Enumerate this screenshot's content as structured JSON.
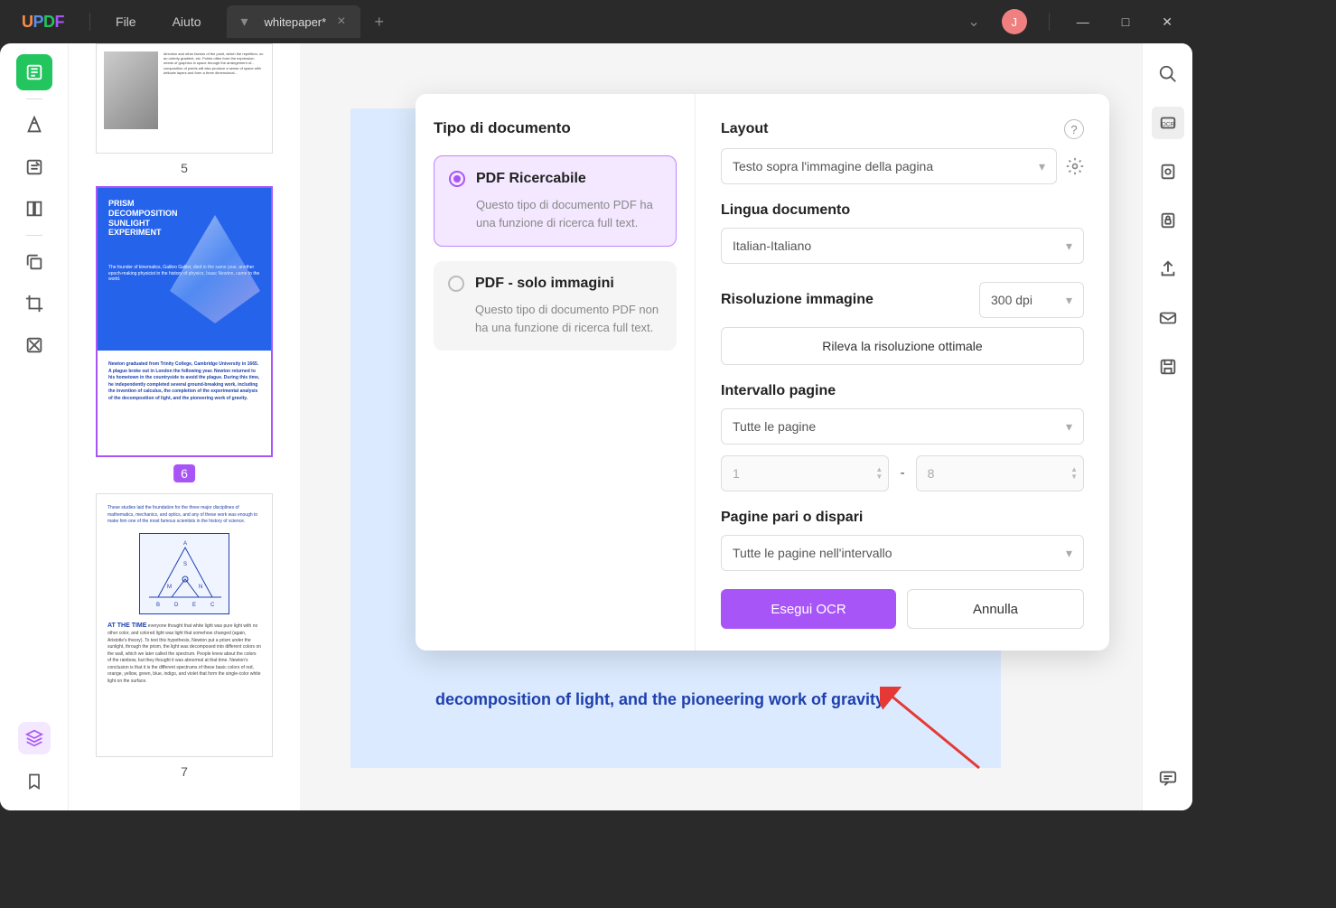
{
  "titlebar": {
    "menu_file": "File",
    "menu_help": "Aiuto",
    "tab_title": "whitepaper*",
    "avatar_letter": "J"
  },
  "thumbs": {
    "p5": "5",
    "p6": "6",
    "p7": "7",
    "t6_title": "PRISM\nDECOMPOSITION\nSUNLIGHT\nEXPERIMENT",
    "t7_title": "AT THE TIME"
  },
  "doc": {
    "visible_line": "decomposition of light, and the pioneering work of gravity."
  },
  "ocr": {
    "doc_type_heading": "Tipo di documento",
    "opt1_title": "PDF Ricercabile",
    "opt1_desc": "Questo tipo di documento PDF ha una funzione di ricerca full text.",
    "opt2_title": "PDF - solo immagini",
    "opt2_desc": "Questo tipo di documento PDF non ha una funzione di ricerca full text.",
    "layout_label": "Layout",
    "layout_value": "Testo sopra l'immagine della pagina",
    "lang_label": "Lingua documento",
    "lang_value": "Italian-Italiano",
    "res_label": "Risoluzione immagine",
    "res_value": "300 dpi",
    "detect_btn": "Rileva la risoluzione ottimale",
    "range_label": "Intervallo pagine",
    "range_value": "Tutte le pagine",
    "range_from": "1",
    "range_to": "8",
    "odd_even_label": "Pagine pari o dispari",
    "odd_even_value": "Tutte le pagine nell'intervallo",
    "run_btn": "Esegui OCR",
    "cancel_btn": "Annulla"
  }
}
